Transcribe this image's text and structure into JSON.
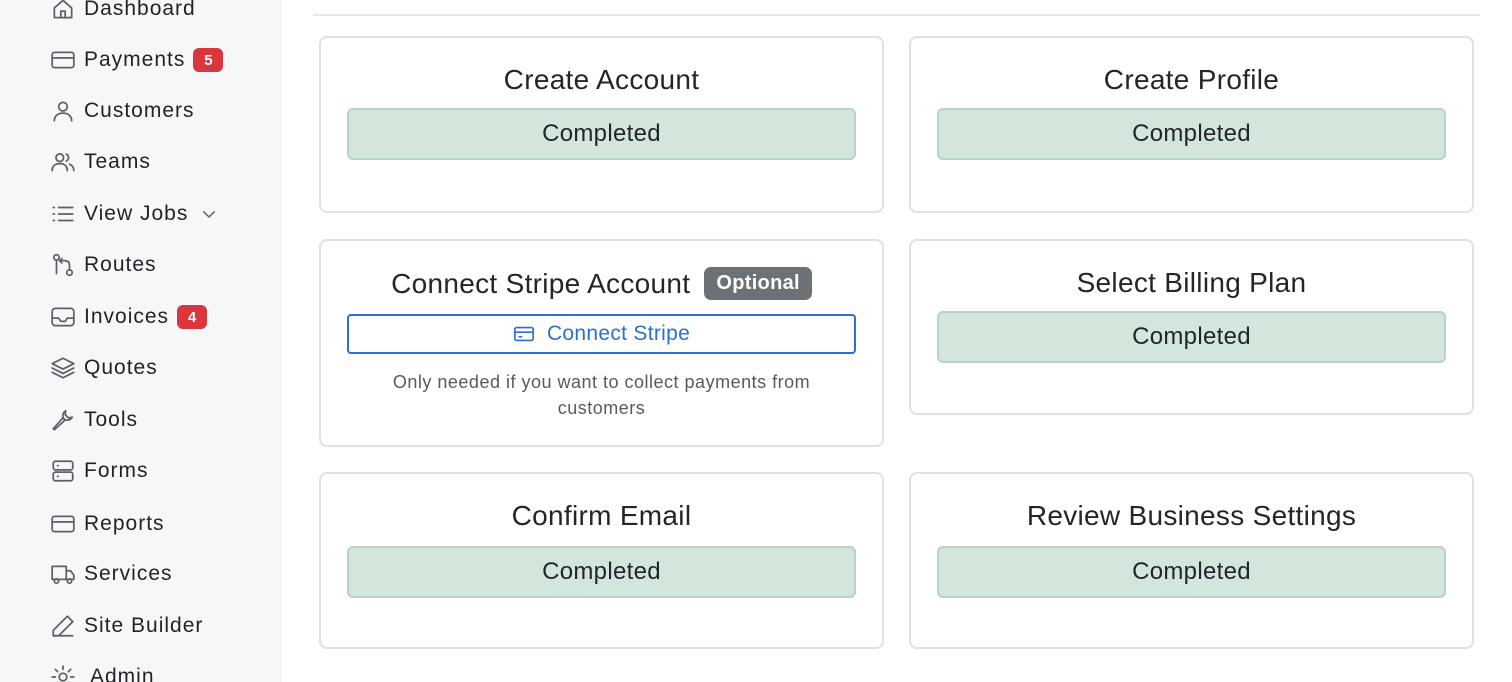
{
  "sidebar": {
    "items": [
      {
        "label": "Dashboard",
        "icon": "home-icon"
      },
      {
        "label": "Payments",
        "icon": "credit-card-icon",
        "badge": "5"
      },
      {
        "label": "Customers",
        "icon": "user-icon"
      },
      {
        "label": "Teams",
        "icon": "users-icon"
      },
      {
        "label": "View Jobs",
        "icon": "list-icon",
        "chevron": "chevron-down-icon"
      },
      {
        "label": "Routes",
        "icon": "route-icon"
      },
      {
        "label": "Invoices",
        "icon": "inbox-icon",
        "badge": "4"
      },
      {
        "label": "Quotes",
        "icon": "layers-icon"
      },
      {
        "label": "Tools",
        "icon": "wrench-icon"
      },
      {
        "label": "Forms",
        "icon": "server-icon"
      },
      {
        "label": "Reports",
        "icon": "credit-card-icon"
      },
      {
        "label": "Services",
        "icon": "truck-icon"
      },
      {
        "label": "Site Builder",
        "icon": "pen-icon"
      },
      {
        "label": "Admin",
        "icon": "gear-icon"
      }
    ]
  },
  "steps": {
    "create_account": {
      "title": "Create Account",
      "status": "Completed"
    },
    "create_profile": {
      "title": "Create Profile",
      "status": "Completed"
    },
    "connect_stripe": {
      "title": "Connect Stripe Account",
      "badge": "Optional",
      "button_label": "Connect Stripe",
      "button_icon": "credit-card-icon",
      "help_text": "Only needed if you want to collect payments from customers"
    },
    "billing_plan": {
      "title": "Select Billing Plan",
      "status": "Completed"
    },
    "confirm_email": {
      "title": "Confirm Email",
      "status": "Completed"
    },
    "business_settings": {
      "title": "Review Business Settings",
      "status": "Completed"
    }
  },
  "colors": {
    "completed_bg": "#d2e6dc",
    "badge_red": "#d9363e",
    "optional_gray": "#6c7176",
    "link_blue": "#2d6fd1"
  }
}
